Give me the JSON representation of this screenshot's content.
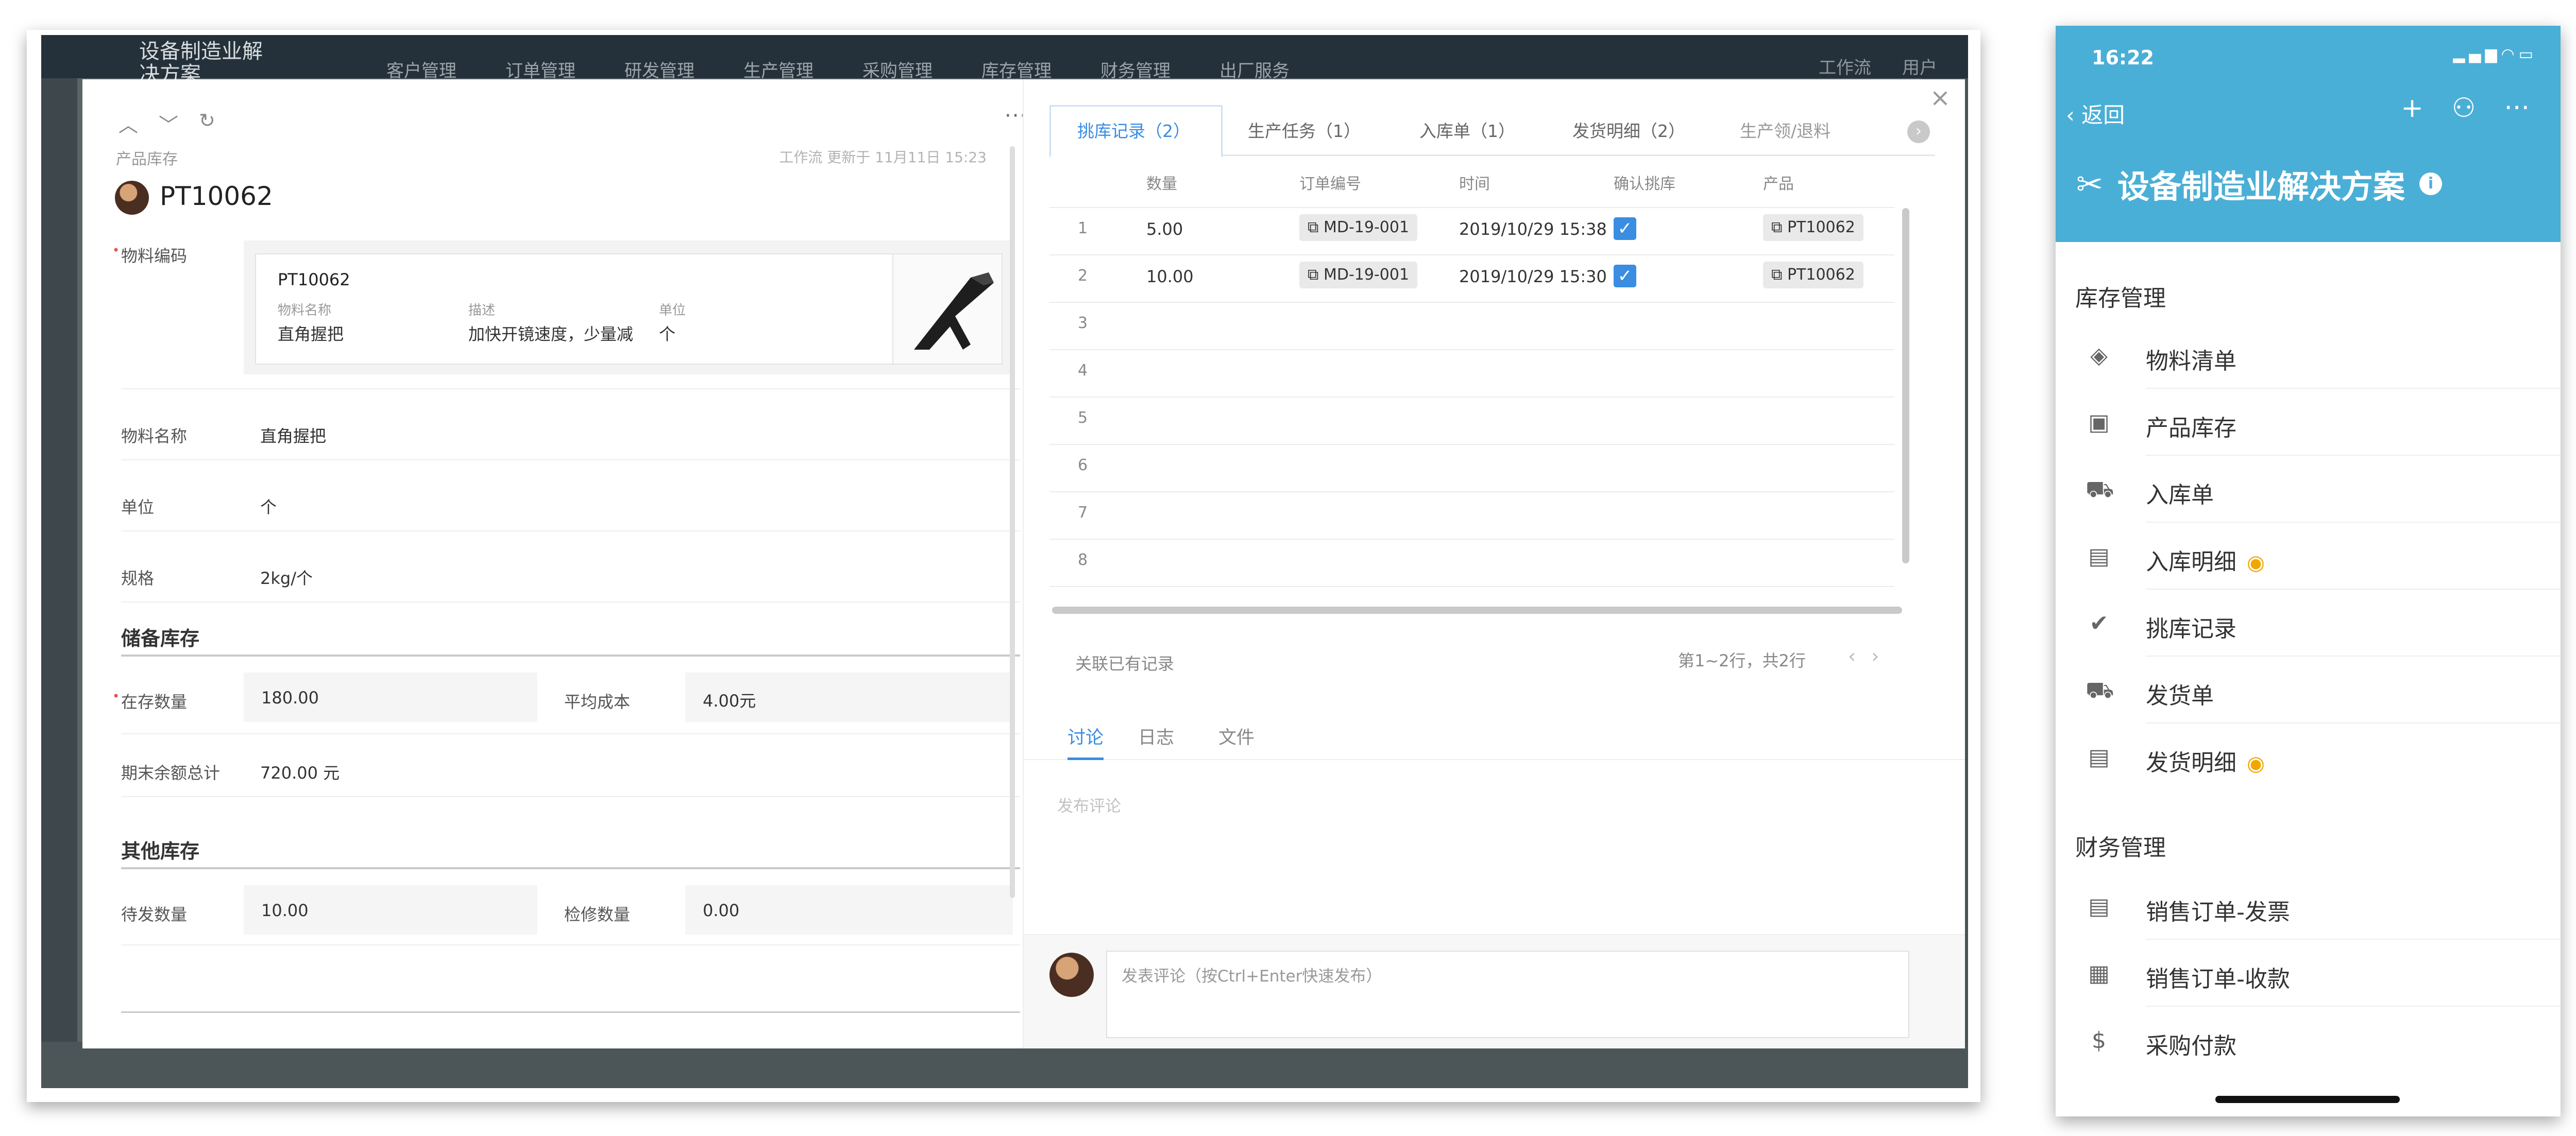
{
  "app": {
    "title": "设备制造业解决方案",
    "nav": [
      "客户管理",
      "订单管理",
      "研发管理",
      "生产管理",
      "采购管理",
      "库存管理",
      "财务管理",
      "出厂服务"
    ],
    "right": [
      "工作流",
      "用户"
    ]
  },
  "record": {
    "breadcrumb": "产品库存",
    "updated": "工作流 更新于 11月11日 15:23",
    "id": "PT10062",
    "material_code_label": "物料编码",
    "material_card": {
      "code": "PT10062",
      "headers": [
        "物料名称",
        "描述",
        "单位"
      ],
      "values": [
        "直角握把",
        "加快开镜速度，少量减",
        "个"
      ]
    },
    "fields": [
      {
        "label": "物料名称",
        "value": "直角握把"
      },
      {
        "label": "单位",
        "value": "个"
      },
      {
        "label": "规格",
        "value": "2kg/个"
      }
    ],
    "reserve": {
      "section": "储备库存",
      "stock_label": "在存数量",
      "stock_value": "180.00",
      "cost_label": "平均成本",
      "cost_value": "4.00元",
      "total_label": "期末余额总计",
      "total_value": "720.00 元"
    },
    "other": {
      "section": "其他库存",
      "pending_label": "待发数量",
      "pending_value": "10.00",
      "repair_label": "检修数量",
      "repair_value": "0.00"
    }
  },
  "related": {
    "tabs": [
      "挑库记录（2）",
      "生产任务（1）",
      "入库单（1）",
      "发货明细（2）",
      "生产领/退料"
    ],
    "columns": [
      "数量",
      "订单编号",
      "时间",
      "确认挑库",
      "产品"
    ],
    "rows": [
      {
        "n": "1",
        "qty": "5.00",
        "order": "MD-19-001",
        "time": "2019/10/29 15:38",
        "product": "PT10062"
      },
      {
        "n": "2",
        "qty": "10.00",
        "order": "MD-19-001",
        "time": "2019/10/29 15:30",
        "product": "PT10062"
      }
    ],
    "empty_rows": [
      "3",
      "4",
      "5",
      "6",
      "7",
      "8"
    ],
    "assoc": "关联已有记录",
    "pager": "第1~2行，共2行"
  },
  "discussion": {
    "tabs": [
      "讨论",
      "日志",
      "文件"
    ],
    "post_placeholder": "发布评论",
    "comment_placeholder": "发表评论（按Ctrl+Enter快速发布）"
  },
  "phone": {
    "time": "16:22",
    "back": "返回",
    "title": "设备制造业解决方案",
    "sections": [
      {
        "title": "库存管理",
        "items": [
          {
            "label": "物料清单",
            "icon": "layers-icon",
            "hidden": false
          },
          {
            "label": "产品库存",
            "icon": "gift-icon",
            "hidden": false
          },
          {
            "label": "入库单",
            "icon": "cart-icon",
            "hidden": false
          },
          {
            "label": "入库明细",
            "icon": "receipt-icon",
            "hidden": true
          },
          {
            "label": "挑库记录",
            "icon": "check-circle-icon",
            "hidden": false
          },
          {
            "label": "发货单",
            "icon": "truck-icon",
            "hidden": false
          },
          {
            "label": "发货明细",
            "icon": "receipt-icon",
            "hidden": true
          }
        ]
      },
      {
        "title": "财务管理",
        "items": [
          {
            "label": "销售订单-发票",
            "icon": "receipt-icon",
            "hidden": false
          },
          {
            "label": "销售订单-收款",
            "icon": "calculator-icon",
            "hidden": false
          },
          {
            "label": "采购付款",
            "icon": "dollar-icon",
            "hidden": false
          }
        ]
      }
    ]
  },
  "colors": {
    "accent": "#3a8de0",
    "phone_header": "#4aafd6",
    "eye": "#f0a800"
  }
}
